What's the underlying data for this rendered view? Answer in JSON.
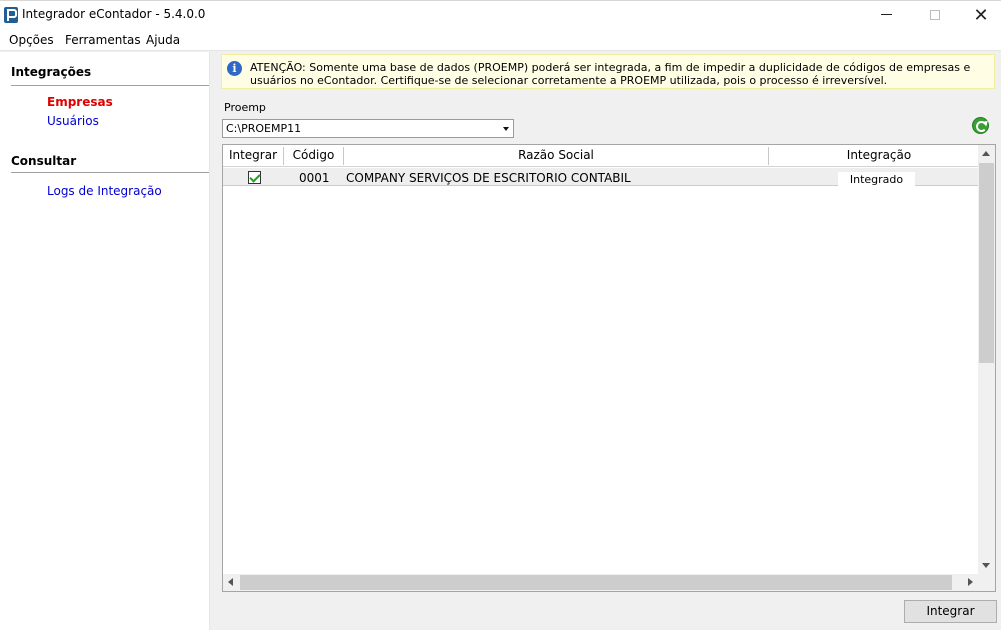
{
  "window": {
    "title": "Integrador eContador - 5.4.0.0",
    "minimize_label": "",
    "maximize_label": "",
    "close_label": "✕"
  },
  "menu": {
    "items": [
      "Opções",
      "Ferramentas",
      "Ajuda"
    ]
  },
  "sidebar": {
    "sections": [
      {
        "title": "Integrações",
        "links": [
          {
            "label": "Empresas",
            "active": true
          },
          {
            "label": "Usuários",
            "active": false
          }
        ]
      },
      {
        "title": "Consultar",
        "links": [
          {
            "label": "Logs de Integração",
            "active": false
          }
        ]
      }
    ]
  },
  "alert": {
    "icon": "info-icon",
    "text": "ATENÇÃO: Somente uma base de dados (PROEMP) poderá ser integrada, a fim de impedir a duplicidade de códigos de empresas e usuários no eContador. Certifique-se de selecionar corretamente a PROEMP utilizada, pois o processo é irreversível."
  },
  "proemp": {
    "label": "Proemp",
    "value": "C:\\PROEMP11"
  },
  "grid": {
    "columns": [
      "Integrar",
      "Código",
      "Razão Social",
      "Integração"
    ],
    "rows": [
      {
        "checked": true,
        "codigo": "0001",
        "razao_social": "COMPANY SERVIÇOS DE ESCRITORIO CONTABIL",
        "integracao": "Integrado"
      }
    ]
  },
  "footer": {
    "integrar_label": "Integrar"
  },
  "colors": {
    "active_link": "#e00000",
    "link": "#0000d0",
    "alert_bg": "#fffee5",
    "info_icon": "#2f68c5",
    "refresh_icon": "#3aa033"
  }
}
